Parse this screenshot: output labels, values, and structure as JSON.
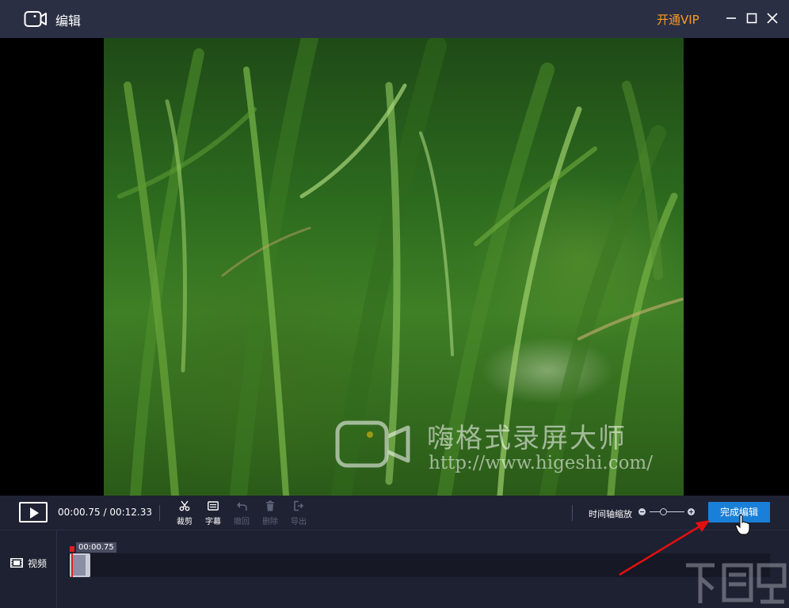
{
  "window": {
    "title": "编辑",
    "vip_label": "开通VIP",
    "controls": [
      "minimize-icon",
      "maximize-icon",
      "close-icon"
    ]
  },
  "preview": {
    "watermark_name": "嗨格式录屏大师",
    "watermark_url": "http://www.higeshi.com/"
  },
  "toolbar": {
    "current_time": "00:00.75",
    "total_time": "00:12.33",
    "time_display": "00:00.75 / 00:12.33",
    "tools": [
      {
        "label": "裁剪",
        "icon": "scissors-icon",
        "enabled": true
      },
      {
        "label": "字幕",
        "icon": "subtitle-icon",
        "enabled": true
      },
      {
        "label": "撤回",
        "icon": "undo-icon",
        "enabled": false
      },
      {
        "label": "删除",
        "icon": "trash-icon",
        "enabled": false
      },
      {
        "label": "导出",
        "icon": "export-icon",
        "enabled": false
      }
    ],
    "zoom_label": "时间轴缩放",
    "zoom_level": 0.3,
    "done_label": "完成编辑"
  },
  "timeline": {
    "track_name": "视频",
    "playhead_time": "00:00.75"
  },
  "colors": {
    "titlebar": "#2b2f44",
    "vip": "#ff9a1f",
    "accent": "#1a7fd8",
    "playhead": "#e02020"
  }
}
